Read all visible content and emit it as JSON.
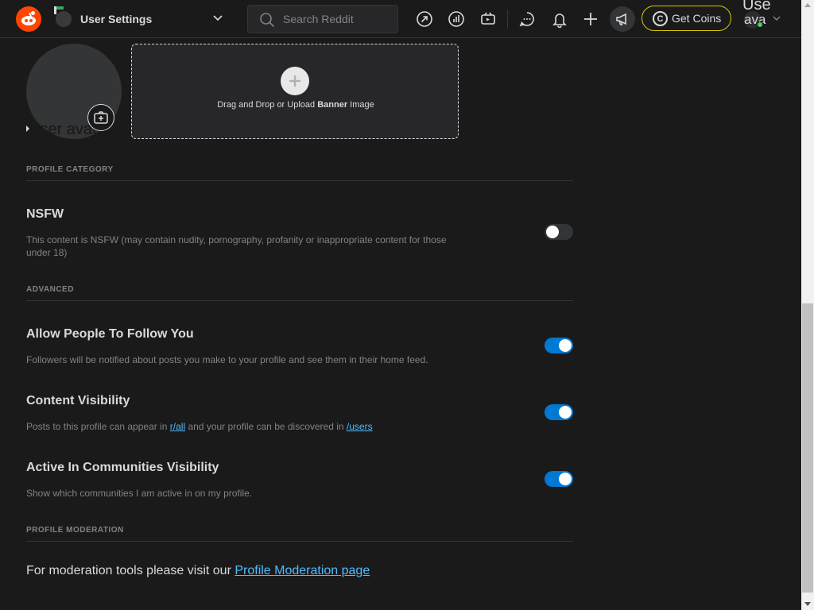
{
  "header": {
    "title": "User Settings",
    "search_placeholder": "Search Reddit",
    "get_coins_label": "Get Coins",
    "coin_symbol": "C",
    "user_label_top": "Use",
    "user_label_bottom": "ava",
    "icons": [
      "reddit-logo",
      "popular-arrow-icon",
      "stats-icon",
      "video-icon",
      "chat-icon",
      "notification-bell-icon",
      "create-plus-icon",
      "advertise-megaphone-icon",
      "coin-icon",
      "chevron-down-icon"
    ]
  },
  "profile": {
    "avatar_alt": "User avatar",
    "banner": {
      "text_before": "Drag and Drop or Upload ",
      "text_bold": "Banner",
      "text_after": " Image"
    }
  },
  "sections": {
    "profile_category": "PROFILE CATEGORY",
    "advanced": "ADVANCED",
    "profile_moderation": "PROFILE MODERATION"
  },
  "settings": {
    "nsfw": {
      "title": "NSFW",
      "description": "This content is NSFW (may contain nudity, pornography, profanity or inappropriate content for those under 18)",
      "enabled": false
    },
    "allow_follow": {
      "title": "Allow People To Follow You",
      "description": "Followers will be notified about posts you make to your profile and see them in their home feed.",
      "enabled": true
    },
    "content_visibility": {
      "title": "Content Visibility",
      "desc_before": "Posts to this profile can appear in ",
      "link_all": "r/all",
      "desc_middle": " and your profile can be discovered in ",
      "link_users": "/users",
      "enabled": true
    },
    "communities_visibility": {
      "title": "Active In Communities Visibility",
      "description": "Show which communities I am active in on my profile.",
      "enabled": true
    }
  },
  "moderation": {
    "text": "For moderation tools please visit our ",
    "link": "Profile Moderation page"
  },
  "colors": {
    "background": "#1a1a1b",
    "accent": "#0079d3",
    "link": "#4fbcff",
    "brand": "#ff4500",
    "coins_border": "#d7c800"
  }
}
